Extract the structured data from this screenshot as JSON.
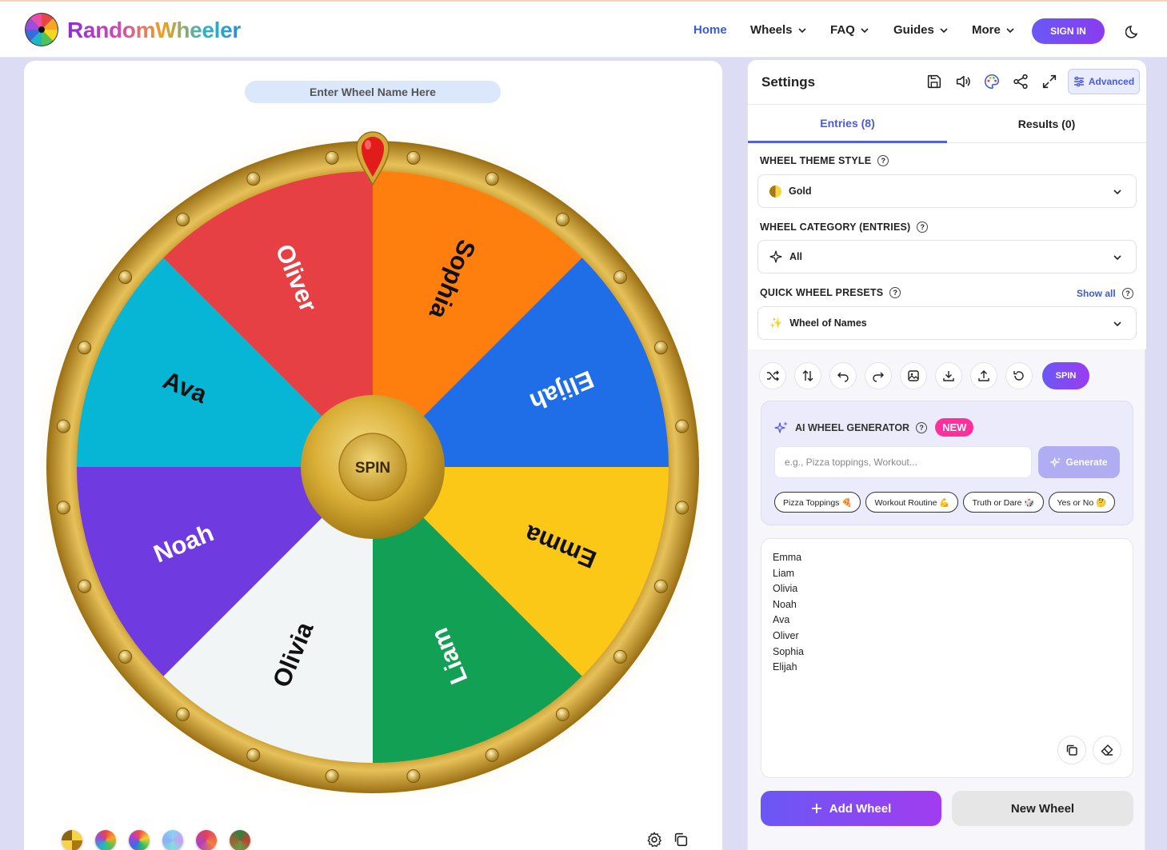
{
  "app": {
    "name": "RandomWheeler",
    "nav": [
      {
        "label": "Home",
        "active": true
      },
      {
        "label": "Wheels"
      },
      {
        "label": "FAQ"
      },
      {
        "label": "Guides"
      },
      {
        "label": "More"
      }
    ],
    "sign_in": "SIGN IN"
  },
  "wheel": {
    "name_placeholder": "Enter Wheel Name Here",
    "spin_label": "SPIN",
    "segments": [
      {
        "label": "Sophia",
        "color": "#ff7f0e",
        "text_color": "#111111"
      },
      {
        "label": "Elijah",
        "color": "#1f6ee8",
        "text_color": "#ffffff"
      },
      {
        "label": "Emma",
        "color": "#fcc817",
        "text_color": "#111111"
      },
      {
        "label": "Liam",
        "color": "#12a055",
        "text_color": "#ffffff"
      },
      {
        "label": "Olivia",
        "color": "#f2f5f5",
        "text_color": "#111111"
      },
      {
        "label": "Noah",
        "color": "#6f3be0",
        "text_color": "#ffffff"
      },
      {
        "label": "Ava",
        "color": "#06b6d4",
        "text_color": "#111111"
      },
      {
        "label": "Oliver",
        "color": "#e74044",
        "text_color": "#ffffff"
      }
    ],
    "theme_swatches": [
      "gold",
      "rainbow",
      "spectrum",
      "pastel",
      "warm",
      "earth"
    ]
  },
  "settings": {
    "title": "Settings",
    "advanced_label": "Advanced",
    "tabs": [
      {
        "label": "Entries (8)",
        "active": true
      },
      {
        "label": "Results (0)"
      }
    ],
    "theme_style": {
      "label": "WHEEL THEME STYLE",
      "value": "Gold"
    },
    "category": {
      "label": "WHEEL CATEGORY (ENTRIES)",
      "value": "All"
    },
    "presets": {
      "label": "QUICK WHEEL PRESETS",
      "show_all": "Show all",
      "value": "Wheel of Names"
    },
    "spin_label": "SPIN",
    "ai": {
      "title": "AI WHEEL GENERATOR",
      "badge": "NEW",
      "placeholder": "e.g., Pizza toppings, Workout...",
      "generate": "Generate",
      "chips": [
        "Pizza Toppings 🍕",
        "Workout Routine 💪",
        "Truth or Dare 🎲",
        "Yes or No 🤔"
      ]
    },
    "entries": [
      "Emma",
      "Liam",
      "Olivia",
      "Noah",
      "Ava",
      "Oliver",
      "Sophia",
      "Elijah"
    ],
    "add_wheel": "Add Wheel",
    "new_wheel": "New Wheel"
  }
}
